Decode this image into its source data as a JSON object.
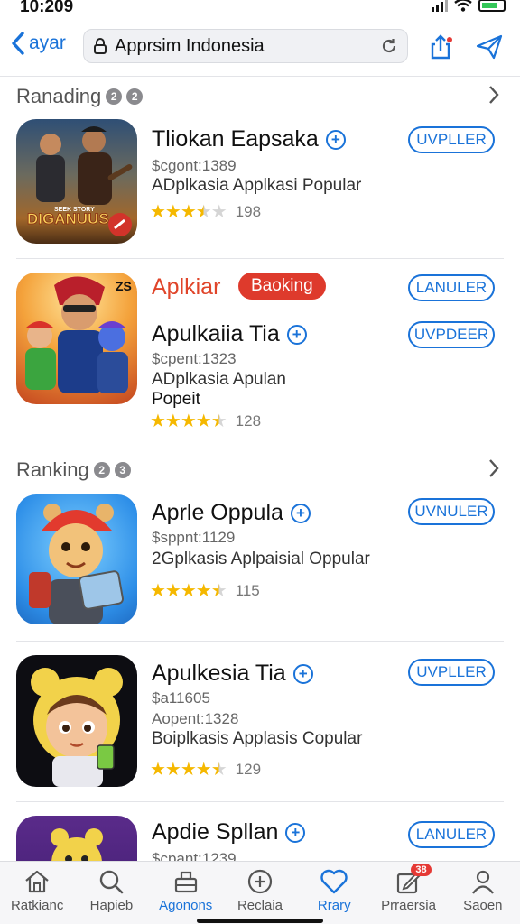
{
  "status": {
    "time": "10:209"
  },
  "nav": {
    "back_label": "ayar",
    "search_value": "Apprsim Indonesia"
  },
  "sections": [
    {
      "title": "Ranading",
      "counts": [
        "2",
        "2"
      ]
    },
    {
      "title": "Ranking",
      "counts": [
        "2",
        "3"
      ]
    }
  ],
  "apps": [
    {
      "name": "Tliokan Eapsaka",
      "meta": "$cgont:1389",
      "desc": "ADplkasia Applkasi Popular",
      "rating": 3.5,
      "rating_count": "198",
      "button": "UVPLLER",
      "icon_text": "DIGANUUS",
      "icon_sub": "SEEK STORY"
    },
    {
      "accent_title": "Aplkiar",
      "badge": "Baoking",
      "button_top": "LANULER",
      "name": "Apulkaiia Tia",
      "meta": "$cpent:1323",
      "desc": "ADplkasia Apulan",
      "desc2": "Popeit",
      "rating": 4.5,
      "rating_count": "128",
      "button": "UVPDEER",
      "icon_text": "ZS"
    },
    {
      "name": "Aprle Oppula",
      "meta": "$sppnt:1129",
      "desc": "2Gplkasis Aplpaisial Oppular",
      "rating": 4.5,
      "rating_count": "115",
      "button": "UVNULER"
    },
    {
      "name": "Apulkesia Tia",
      "meta": "$a11605",
      "meta2": "Aopent:1328",
      "desc": "Boiplkasis Applasis Copular",
      "rating": 4.5,
      "rating_count": "129",
      "button": "UVPLLER"
    },
    {
      "name": "Apdie Spllan",
      "meta": "$cpant:1239",
      "button": "LANULER"
    }
  ],
  "tabs": [
    {
      "label": "Ratkianc",
      "icon": "home-icon"
    },
    {
      "label": "Hapieb",
      "icon": "search-icon"
    },
    {
      "label": "Agonons",
      "icon": "store-icon",
      "active": true
    },
    {
      "label": "Reclaia",
      "icon": "plus-icon"
    },
    {
      "label": "Rrary",
      "icon": "heart-icon"
    },
    {
      "label": "Prraersia",
      "icon": "edit-icon",
      "badge": "38"
    },
    {
      "label": "Saoen",
      "icon": "person-icon"
    }
  ],
  "colors": {
    "accent": "#1a73d9",
    "badge": "#de3a2c",
    "star": "#f5b800"
  }
}
